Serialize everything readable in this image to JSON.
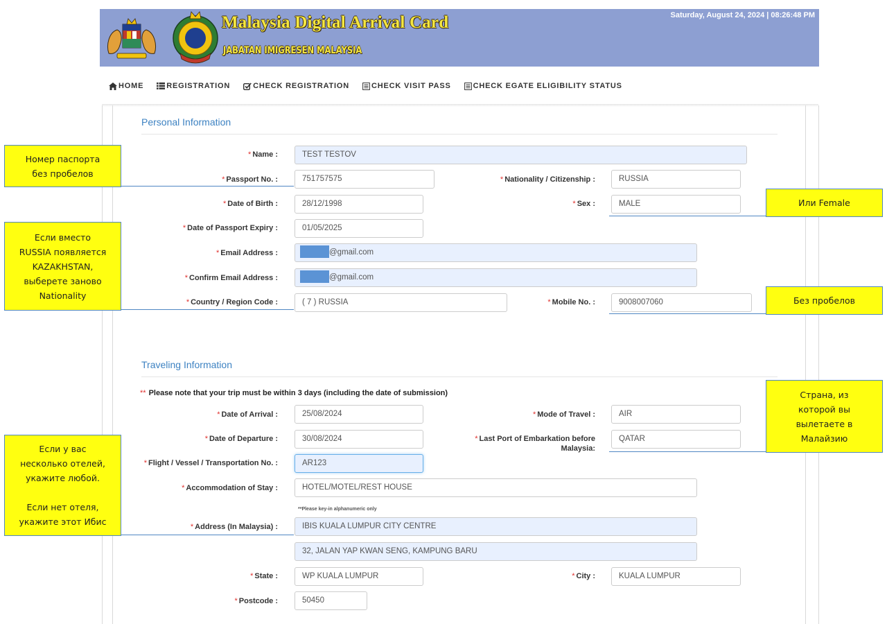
{
  "header": {
    "title": "Malaysia Digital Arrival Card",
    "subtitle": "JABATAN IMIGRESEN MALAYSIA",
    "datetime": "Saturday, August 24, 2024 | 08:26:48 PM",
    "colors": {
      "banner": "#8d9fd2",
      "title": "#f4e640"
    }
  },
  "nav": {
    "items": [
      {
        "label": "HOME",
        "icon": "home-icon"
      },
      {
        "label": "REGISTRATION",
        "icon": "list-icon"
      },
      {
        "label": "CHECK REGISTRATION",
        "icon": "check-square-icon"
      },
      {
        "label": "CHECK VISIT PASS",
        "icon": "document-icon"
      },
      {
        "label": "CHECK EGATE ELIGIBILITY STATUS",
        "icon": "document-icon"
      }
    ]
  },
  "personal": {
    "section_title": "Personal Information",
    "name": {
      "label": "Name :",
      "value": "TEST TESTOV"
    },
    "passport": {
      "label": "Passport No. :",
      "value": "751757575"
    },
    "nationality": {
      "label": "Nationality / Citizenship :",
      "value": "RUSSIA"
    },
    "dob": {
      "label": "Date of Birth :",
      "value": "28/12/1998"
    },
    "sex": {
      "label": "Sex :",
      "value": "MALE"
    },
    "passport_expiry": {
      "label": "Date of Passport Expiry :",
      "value": "01/05/2025"
    },
    "email": {
      "label": "Email Address :",
      "value": "@gmail.com"
    },
    "confirm_email": {
      "label": "Confirm Email Address :",
      "value": "@gmail.com"
    },
    "country_code": {
      "label": "Country / Region Code :",
      "value": "( 7 ) RUSSIA"
    },
    "mobile": {
      "label": "Mobile No. :",
      "value": "9008007060"
    }
  },
  "traveling": {
    "section_title": "Traveling Information",
    "note": "Please note that your trip must be within 3 days (including the date of submission)",
    "note_marker": "**",
    "arrival": {
      "label": "Date of Arrival :",
      "value": "25/08/2024"
    },
    "mode": {
      "label": "Mode of Travel :",
      "value": "AIR"
    },
    "departure": {
      "label": "Date of Departure :",
      "value": "30/08/2024"
    },
    "last_port": {
      "label": "Last Port of Embarkation before Malaysia:",
      "value": "QATAR"
    },
    "flight": {
      "label": "Flight / Vessel / Transportation No. :",
      "value": "AR123"
    },
    "accommodation": {
      "label": "Accommodation of Stay :",
      "value": "HOTEL/MOTEL/REST HOUSE"
    },
    "alnum_note": "**Please key-in alphanumeric only",
    "address": {
      "label": "Address (In Malaysia) :",
      "line1": "IBIS KUALA LUMPUR CITY CENTRE",
      "line2": "32, JALAN YAP KWAN SENG, KAMPUNG BARU"
    },
    "state": {
      "label": "State :",
      "value": "WP KUALA LUMPUR"
    },
    "city": {
      "label": "City :",
      "value": "KUALA LUMPUR"
    },
    "postcode": {
      "label": "Postcode :",
      "value": "50450"
    }
  },
  "required_marker": "*",
  "callouts": {
    "passport": [
      "Номер паспорта",
      "без пробелов"
    ],
    "nationality": [
      "Если вместо",
      "RUSSIA появляется",
      "KAZAKHSTAN,",
      "выберете заново",
      "Nationality"
    ],
    "sex": [
      "Или Female"
    ],
    "mobile": [
      "Без пробелов"
    ],
    "last_port": [
      "Страна, из",
      "которой вы",
      "вылетаете в",
      "Малайзию"
    ],
    "hotel": [
      "Если у вас",
      "несколько отелей,",
      "укажите любой.",
      "",
      "Если нет отеля,",
      "укажите этот Ибис"
    ],
    "color": "#ffff10",
    "border_color": "#4f86c3"
  }
}
